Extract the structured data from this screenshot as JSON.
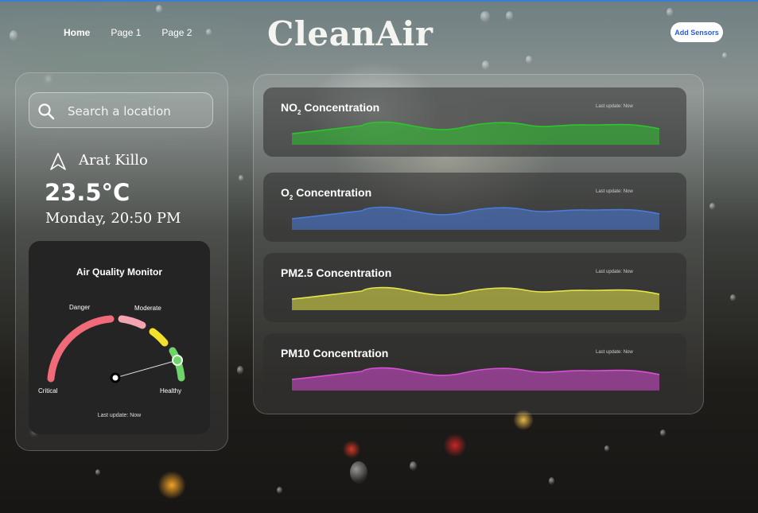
{
  "nav": {
    "items": [
      {
        "label": "Home",
        "active": true
      },
      {
        "label": "Page 1"
      },
      {
        "label": "Page 2"
      }
    ]
  },
  "brand": "CleanAir",
  "add_sensors_label": "Add Sensors",
  "search": {
    "placeholder": "Search a location"
  },
  "location": {
    "name": "Arat Killo",
    "temperature": "23.5°C",
    "datetime": "Monday, 20:50 PM"
  },
  "air_quality_monitor": {
    "title": "Air Quality Monitor",
    "labels": {
      "danger": "Danger",
      "moderate": "Moderate",
      "critical": "Critical",
      "healthy": "Healthy"
    },
    "last_update": "Last update: Now",
    "colors": {
      "critical": "#f06a7a",
      "danger": "#f4a3b0",
      "moderate": "#f2e02a",
      "healthy": "#6fd46a"
    },
    "level_percent": 92
  },
  "concentrations": [
    {
      "title": "NO",
      "subscript": "2",
      "title_suffix": " Concentration",
      "last_update": "Last update: Now",
      "color": "#2ec42e"
    },
    {
      "title": "O",
      "subscript": "2",
      "title_suffix": " Concentration",
      "last_update": "Last update: Now",
      "color": "#4a7bdc"
    },
    {
      "title": "PM2.5",
      "subscript": "",
      "title_suffix": " Concentration",
      "last_update": "Last update: Now",
      "color": "#e7e54a"
    },
    {
      "title": "PM10",
      "subscript": "",
      "title_suffix": " Concentration",
      "last_update": "Last update: Now",
      "color": "#d84fd6"
    }
  ]
}
